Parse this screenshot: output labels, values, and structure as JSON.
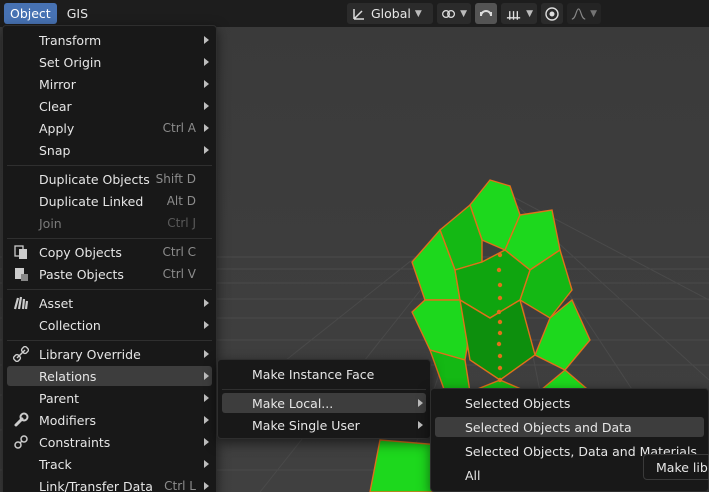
{
  "header": {
    "menus": [
      {
        "label": "Object",
        "active": true
      },
      {
        "label": "GIS",
        "active": false
      }
    ],
    "orientation": "Global"
  },
  "object_menu": {
    "items": [
      {
        "label": "Transform",
        "shortcut": "",
        "submenu": true
      },
      {
        "label": "Set Origin",
        "shortcut": "",
        "submenu": true
      },
      {
        "label": "Mirror",
        "shortcut": "",
        "submenu": true
      },
      {
        "label": "Clear",
        "shortcut": "",
        "submenu": true
      },
      {
        "label": "Apply",
        "shortcut": "Ctrl A",
        "submenu": true
      },
      {
        "label": "Snap",
        "shortcut": "",
        "submenu": true
      },
      {
        "label": "Duplicate Objects",
        "shortcut": "Shift D",
        "submenu": false
      },
      {
        "label": "Duplicate Linked",
        "shortcut": "Alt D",
        "submenu": false
      },
      {
        "label": "Join",
        "shortcut": "Ctrl J",
        "submenu": false
      },
      {
        "label": "Copy Objects",
        "shortcut": "Ctrl C",
        "submenu": false
      },
      {
        "label": "Paste Objects",
        "shortcut": "Ctrl V",
        "submenu": false
      },
      {
        "label": "Asset",
        "shortcut": "",
        "submenu": true
      },
      {
        "label": "Collection",
        "shortcut": "",
        "submenu": true
      },
      {
        "label": "Library Override",
        "shortcut": "",
        "submenu": true
      },
      {
        "label": "Relations",
        "shortcut": "",
        "submenu": true
      },
      {
        "label": "Parent",
        "shortcut": "",
        "submenu": true
      },
      {
        "label": "Modifiers",
        "shortcut": "",
        "submenu": true
      },
      {
        "label": "Constraints",
        "shortcut": "",
        "submenu": true
      },
      {
        "label": "Track",
        "shortcut": "",
        "submenu": true
      },
      {
        "label": "Link/Transfer Data",
        "shortcut": "Ctrl L",
        "submenu": true
      }
    ]
  },
  "relations_menu": {
    "items": [
      {
        "label": "Make Instance Face",
        "submenu": false
      },
      {
        "label": "Make Local...",
        "submenu": true
      },
      {
        "label": "Make Single User",
        "submenu": true
      }
    ]
  },
  "make_local_menu": {
    "items": [
      {
        "label": "Selected Objects"
      },
      {
        "label": "Selected Objects and Data"
      },
      {
        "label": "Selected Objects, Data and Materials"
      },
      {
        "label": "All"
      }
    ]
  },
  "tooltip": {
    "text": "Make libr"
  },
  "colors": {
    "accent": "#4772b3",
    "menu_bg": "#181818",
    "selection_outline": "#e0701a",
    "mesh_green": "#1dd81d"
  }
}
